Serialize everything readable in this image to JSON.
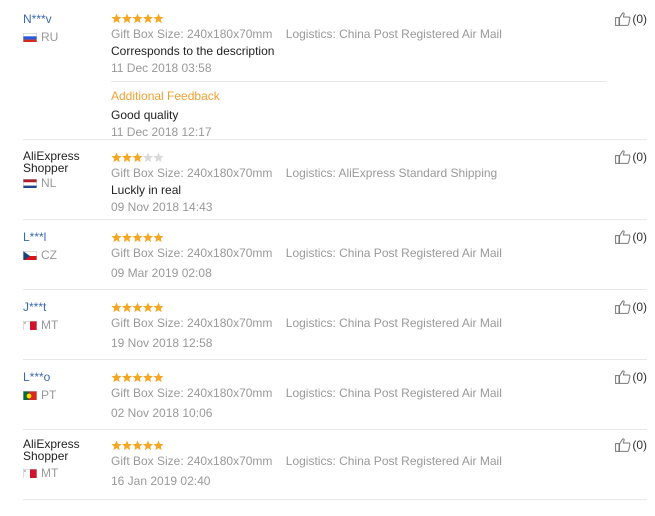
{
  "reviews": [
    {
      "user": "N***v",
      "user_plain": false,
      "country": "RU",
      "flag": "ru",
      "rating": 5,
      "attr_size": "Gift Box Size: 240x180x70mm",
      "attr_logistics": "Logistics: China Post Registered Air Mail",
      "text": "Corresponds to the description",
      "date": "11 Dec 2018 03:58",
      "additional_label": "Additional Feedback",
      "additional_text": "Good quality",
      "additional_date": "11 Dec 2018 12:17",
      "helpful": "(0)"
    },
    {
      "user": "AliExpress Shopper",
      "user_plain": true,
      "country": "NL",
      "flag": "nl",
      "rating": 3,
      "attr_size": "Gift Box Size: 240x180x70mm",
      "attr_logistics": "Logistics: AliExpress Standard Shipping",
      "text": "Luckly in real",
      "date": "09 Nov 2018 14:43",
      "helpful": "(0)"
    },
    {
      "user": "L***l",
      "user_plain": false,
      "country": "CZ",
      "flag": "cz",
      "rating": 5,
      "attr_size": "Gift Box Size: 240x180x70mm",
      "attr_logistics": "Logistics: China Post Registered Air Mail",
      "date": "09 Mar 2019 02:08",
      "helpful": "(0)"
    },
    {
      "user": "J***t",
      "user_plain": false,
      "country": "MT",
      "flag": "mt",
      "rating": 5,
      "attr_size": "Gift Box Size: 240x180x70mm",
      "attr_logistics": "Logistics: China Post Registered Air Mail",
      "date": "19 Nov 2018 12:58",
      "helpful": "(0)"
    },
    {
      "user": "L***o",
      "user_plain": false,
      "country": "PT",
      "flag": "pt",
      "rating": 5,
      "attr_size": "Gift Box Size: 240x180x70mm",
      "attr_logistics": "Logistics: China Post Registered Air Mail",
      "date": "02 Nov 2018 10:06",
      "helpful": "(0)"
    },
    {
      "user": "AliExpress Shopper",
      "user_plain": true,
      "country": "MT",
      "flag": "mt",
      "rating": 5,
      "attr_size": "Gift Box Size: 240x180x70mm",
      "attr_logistics": "Logistics: China Post Registered Air Mail",
      "date": "16 Jan 2019 02:40",
      "helpful": "(0)"
    }
  ],
  "colors": {
    "star_on": "#f5a623",
    "star_off": "#d9d9d9",
    "link": "#3a6ab0",
    "additional": "#f0a030",
    "muted": "#999999"
  },
  "icons": {
    "helpful": "thumbs-up-icon",
    "rating": "star-icon",
    "country": "flag-icon"
  }
}
